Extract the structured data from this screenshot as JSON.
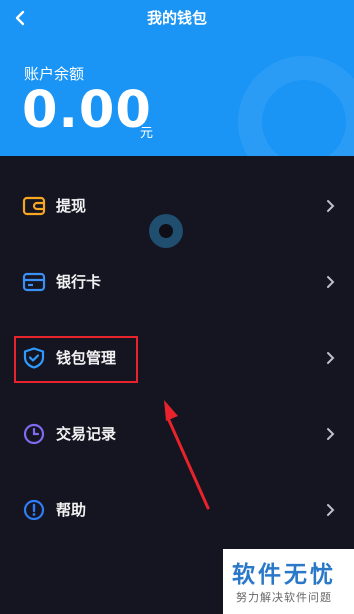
{
  "header": {
    "title": "我的钱包",
    "back_icon": "back-arrow-icon",
    "background": "#1a95f6"
  },
  "balance": {
    "label": "账户余额",
    "amount": "0.00",
    "unit": "元"
  },
  "menu": {
    "items": [
      {
        "label": "提现",
        "icon": "withdraw-wallet-icon",
        "color": "#f5a623"
      },
      {
        "label": "银行卡",
        "icon": "bank-card-icon",
        "color": "#3b8ff5"
      },
      {
        "label": "钱包管理",
        "icon": "shield-check-icon",
        "color": "#2f9bff",
        "highlighted": true
      },
      {
        "label": "交易记录",
        "icon": "clock-icon",
        "color": "#7b6cf0"
      },
      {
        "label": "帮助",
        "icon": "exclamation-circle-icon",
        "color": "#2f7df5"
      }
    ]
  },
  "annotation": {
    "highlight_color": "#e8232b"
  },
  "watermark": {
    "main": "软件无忧",
    "sub": "努力解决软件问题"
  }
}
